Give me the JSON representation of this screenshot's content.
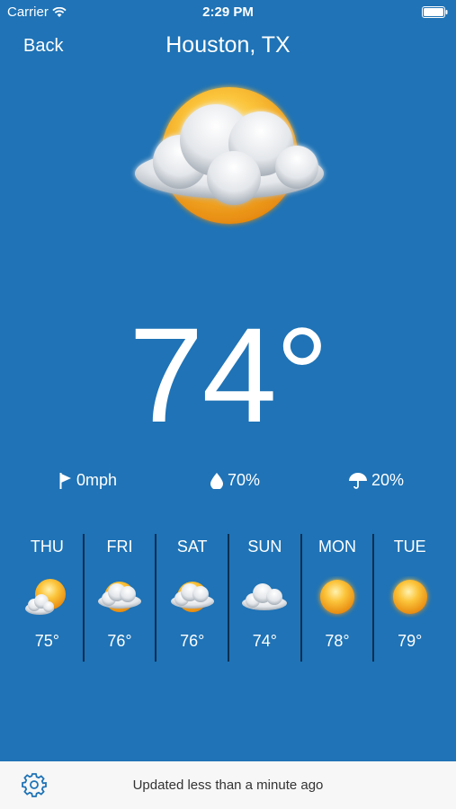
{
  "status_bar": {
    "carrier": "Carrier",
    "time": "2:29 PM"
  },
  "nav": {
    "back_label": "Back",
    "city": "Houston, TX"
  },
  "current": {
    "temperature": "74°",
    "condition_icon": "partly-cloudy-icon",
    "wind": "0mph",
    "humidity": "70%",
    "precipitation": "20%"
  },
  "forecast": [
    {
      "day": "THU",
      "temp": "75°",
      "icon": "sun-cloud-icon"
    },
    {
      "day": "FRI",
      "temp": "76°",
      "icon": "partly-cloudy-icon"
    },
    {
      "day": "SAT",
      "temp": "76°",
      "icon": "partly-cloudy-icon"
    },
    {
      "day": "SUN",
      "temp": "74°",
      "icon": "cloudy-icon"
    },
    {
      "day": "MON",
      "temp": "78°",
      "icon": "sun-icon"
    },
    {
      "day": "TUE",
      "temp": "79°",
      "icon": "sun-icon"
    }
  ],
  "footer": {
    "updated_text": "Updated less than a minute ago"
  },
  "colors": {
    "background": "#1f73b6",
    "divider": "#0d2f52",
    "footer_bg": "#f7f7f7",
    "sun": "#f4a81c"
  }
}
